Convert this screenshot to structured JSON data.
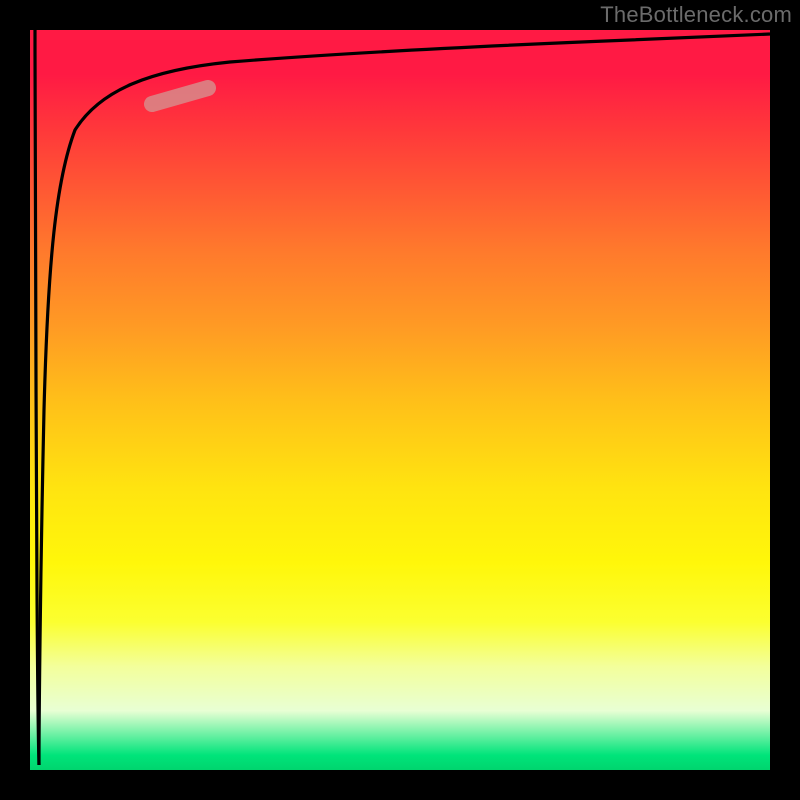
{
  "watermark": "TheBottleneck.com",
  "chart_data": {
    "type": "line",
    "title": "",
    "xlabel": "",
    "ylabel": "",
    "xlim": [
      0,
      100
    ],
    "ylim": [
      0,
      100
    ],
    "grid": false,
    "legend": false,
    "gradient_stops": [
      {
        "pos": 0,
        "color": "#ff1a44"
      },
      {
        "pos": 22,
        "color": "#ff5a33"
      },
      {
        "pos": 50,
        "color": "#ffbf19"
      },
      {
        "pos": 72,
        "color": "#fff70a"
      },
      {
        "pos": 92,
        "color": "#e8ffd4"
      },
      {
        "pos": 100,
        "color": "#00d56e"
      }
    ],
    "series": [
      {
        "name": "curve-down",
        "stroke": "#000000",
        "x": [
          0.5,
          0.6,
          0.7,
          0.8,
          0.9,
          1.0,
          1.1,
          1.2
        ],
        "y": [
          100,
          85,
          60,
          40,
          25,
          12,
          6,
          3
        ]
      },
      {
        "name": "curve-up",
        "stroke": "#000000",
        "x": [
          1.2,
          1.5,
          2,
          3,
          4,
          6,
          8,
          10,
          14,
          20,
          30,
          45,
          60,
          80,
          100
        ],
        "y": [
          3,
          20,
          45,
          68,
          78,
          85,
          88,
          90,
          91.5,
          93,
          94.5,
          96,
          97,
          98,
          99
        ]
      }
    ],
    "marker": {
      "name": "highlight-segment",
      "color": "#d98a8a",
      "x_range": [
        16,
        22
      ],
      "y_range": [
        88.5,
        90.5
      ]
    }
  }
}
